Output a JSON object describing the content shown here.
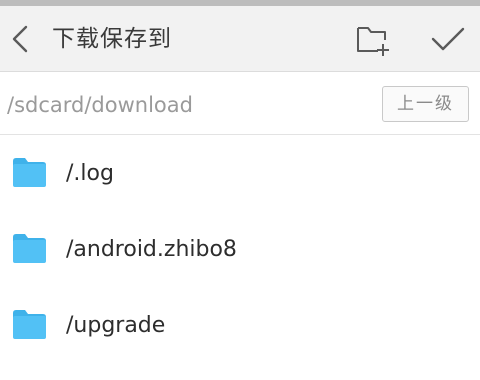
{
  "header": {
    "title": "下载保存到",
    "back_icon": "chevron-left-icon",
    "new_folder_icon": "folder-plus-icon",
    "confirm_icon": "checkmark-icon"
  },
  "pathbar": {
    "path": "/sdcard/download",
    "up_label": "上一级"
  },
  "folders": [
    {
      "name": "/.log"
    },
    {
      "name": "/android.zhibo8"
    },
    {
      "name": "/upgrade"
    }
  ],
  "colors": {
    "folder": "#52c1f5",
    "folder_tab": "#3fb2ea",
    "header_bg": "#f2f2f2",
    "icon_stroke": "#5a5a5a"
  }
}
